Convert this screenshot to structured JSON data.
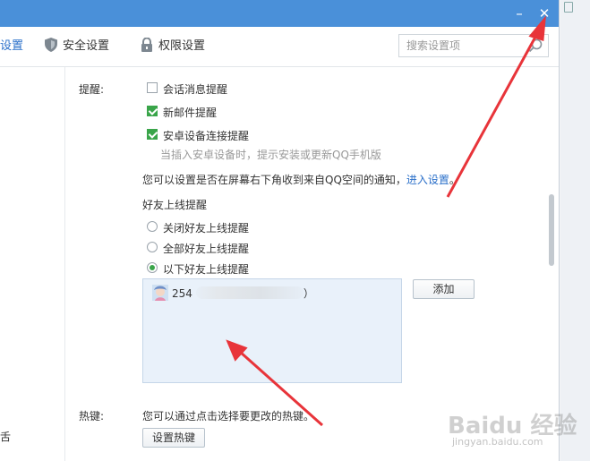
{
  "tabs": [
    {
      "label": "设置"
    },
    {
      "label": "安全设置",
      "icon": "shield-icon"
    },
    {
      "label": "权限设置",
      "icon": "lock-icon"
    }
  ],
  "search": {
    "placeholder": "搜索设置项"
  },
  "window_buttons": {
    "minimize": "–",
    "close": "✕"
  },
  "sidebar": {
    "tail_text": "舌"
  },
  "reminders": {
    "label": "提醒:",
    "options": [
      {
        "label": "会话消息提醒",
        "checked": false
      },
      {
        "label": "新邮件提醒",
        "checked": true
      },
      {
        "label": "安卓设备连接提醒",
        "checked": true
      }
    ],
    "android_hint": "当插入安卓设备时，提示安装或更新QQ手机版",
    "qzone_text": "您可以设置是否在屏幕右下角收到来自QQ空间的通知，",
    "qzone_link": "进入设置",
    "qzone_end": "。"
  },
  "friend_online": {
    "title": "好友上线提醒",
    "options": [
      {
        "label": "关闭好友上线提醒",
        "selected": false
      },
      {
        "label": "全部好友上线提醒",
        "selected": false
      },
      {
        "label": "以下好友上线提醒",
        "selected": true
      }
    ],
    "list": [
      {
        "id_prefix": "254",
        "suffix": "）"
      }
    ],
    "add_button": "添加"
  },
  "hotkey": {
    "label": "热键:",
    "text": "您可以通过点击选择要更改的热键。",
    "button": "设置热键"
  },
  "watermark": {
    "brand": "Baidu 经验",
    "url": "jingyan.baidu.com"
  },
  "colors": {
    "titlebar": "#4a90d9",
    "check": "#3aa54a",
    "link": "#2a6fc9",
    "arrow": "#e8343a"
  }
}
